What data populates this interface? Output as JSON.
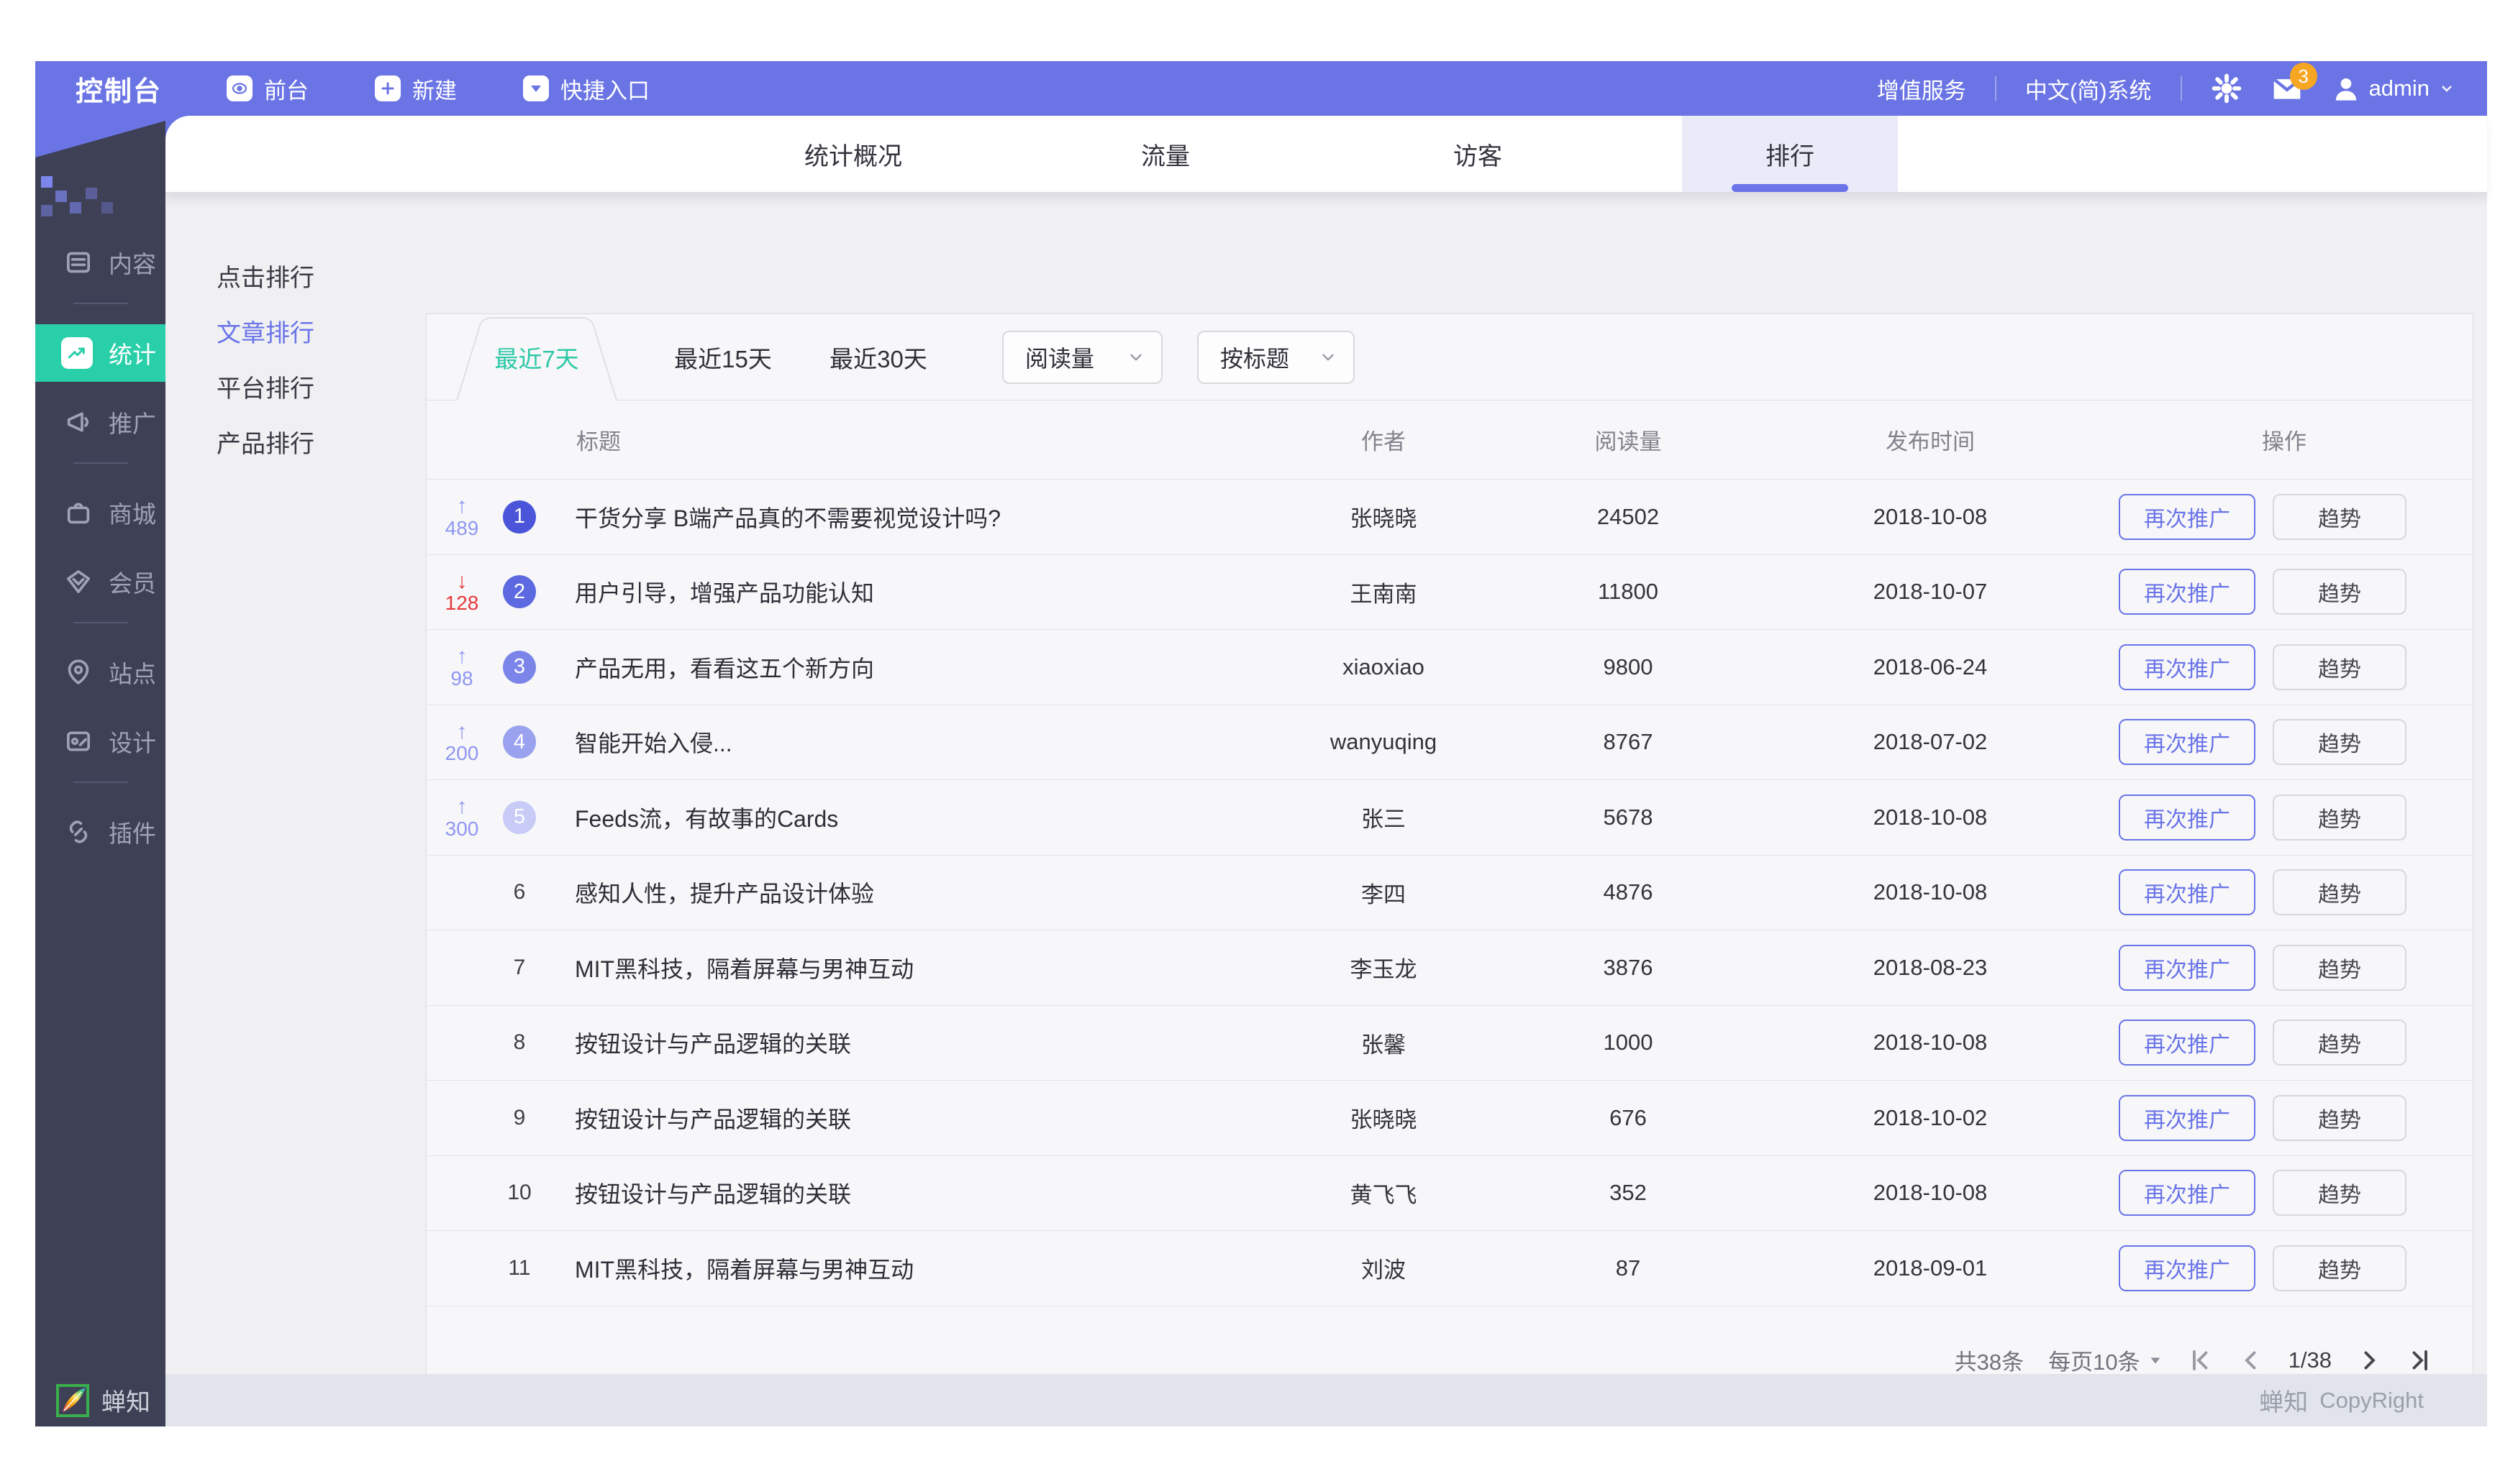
{
  "topbar": {
    "logo": "控制台",
    "menu": [
      {
        "label": "前台",
        "icon": "eye-icon"
      },
      {
        "label": "新建",
        "icon": "plus-icon"
      },
      {
        "label": "快捷入口",
        "icon": "caret-down-icon"
      }
    ],
    "right": {
      "value_added": "增值服务",
      "language": "中文(简)系统",
      "mail_badge": "3",
      "user": "admin"
    }
  },
  "sidebar": {
    "items": [
      {
        "label": "内容",
        "icon": "content-icon",
        "active": false,
        "divider_after": true
      },
      {
        "label": "统计",
        "icon": "stats-icon",
        "active": true,
        "divider_after": false
      },
      {
        "label": "推广",
        "icon": "promo-icon",
        "active": false,
        "divider_after": true
      },
      {
        "label": "商城",
        "icon": "shop-icon",
        "active": false,
        "divider_after": false
      },
      {
        "label": "会员",
        "icon": "member-icon",
        "active": false,
        "divider_after": true
      },
      {
        "label": "站点",
        "icon": "site-icon",
        "active": false,
        "divider_after": false
      },
      {
        "label": "设计",
        "icon": "design-icon",
        "active": false,
        "divider_after": true
      },
      {
        "label": "插件",
        "icon": "plugin-icon",
        "active": false,
        "divider_after": false
      }
    ],
    "brand": "蝉知"
  },
  "navbar": {
    "tabs": [
      {
        "label": "统计概况",
        "active": false
      },
      {
        "label": "流量",
        "active": false
      },
      {
        "label": "访客",
        "active": false
      },
      {
        "label": "排行",
        "active": true
      }
    ]
  },
  "side_menu": {
    "items": [
      {
        "label": "点击排行",
        "active": false
      },
      {
        "label": "文章排行",
        "active": true
      },
      {
        "label": "平台排行",
        "active": false
      },
      {
        "label": "产品排行",
        "active": false
      }
    ]
  },
  "filters": {
    "date_tabs": [
      {
        "label": "最近7天",
        "active": true
      },
      {
        "label": "最近15天",
        "active": false
      },
      {
        "label": "最近30天",
        "active": false
      }
    ],
    "selects": [
      {
        "value": "阅读量"
      },
      {
        "value": "按标题"
      }
    ]
  },
  "table": {
    "headers": [
      "标题",
      "作者",
      "阅读量",
      "发布时间",
      "操作"
    ],
    "action_labels": [
      "再次推广",
      "趋势"
    ],
    "rows": [
      {
        "rank": "1",
        "change": "489",
        "direction": "up",
        "badge_color": "#4a55d9",
        "title": "干货分享 B端产品真的不需要视觉设计吗?",
        "author": "张晓晓",
        "reads": "24502",
        "date": "2018-10-08"
      },
      {
        "rank": "2",
        "change": "128",
        "direction": "down",
        "badge_color": "#5d69e1",
        "title": "用户引导，增强产品功能认知",
        "author": "王南南",
        "reads": "11800",
        "date": "2018-10-07"
      },
      {
        "rank": "3",
        "change": "98",
        "direction": "up",
        "badge_color": "#7b85e9",
        "title": "产品无用，看看这五个新方向",
        "author": "xiaoxiao",
        "reads": "9800",
        "date": "2018-06-24"
      },
      {
        "rank": "4",
        "change": "200",
        "direction": "up",
        "badge_color": "#9aa2ef",
        "title": "智能开始入侵...",
        "author": "wanyuqing",
        "reads": "8767",
        "date": "2018-07-02"
      },
      {
        "rank": "5",
        "change": "300",
        "direction": "up",
        "badge_color": "#c7cbf6",
        "title": "Feeds流，有故事的Cards",
        "author": "张三",
        "reads": "5678",
        "date": "2018-10-08"
      },
      {
        "rank": "6",
        "change": "",
        "direction": "",
        "badge_color": "",
        "title": "感知人性，提升产品设计体验",
        "author": "李四",
        "reads": "4876",
        "date": "2018-10-08"
      },
      {
        "rank": "7",
        "change": "",
        "direction": "",
        "badge_color": "",
        "title": "MIT黑科技，隔着屏幕与男神互动",
        "author": "李玉龙",
        "reads": "3876",
        "date": "2018-08-23"
      },
      {
        "rank": "8",
        "change": "",
        "direction": "",
        "badge_color": "",
        "title": "按钮设计与产品逻辑的关联",
        "author": "张馨",
        "reads": "1000",
        "date": "2018-10-08"
      },
      {
        "rank": "9",
        "change": "",
        "direction": "",
        "badge_color": "",
        "title": "按钮设计与产品逻辑的关联",
        "author": "张晓晓",
        "reads": "676",
        "date": "2018-10-02"
      },
      {
        "rank": "10",
        "change": "",
        "direction": "",
        "badge_color": "",
        "title": "按钮设计与产品逻辑的关联",
        "author": "黄飞飞",
        "reads": "352",
        "date": "2018-10-08"
      },
      {
        "rank": "11",
        "change": "",
        "direction": "",
        "badge_color": "",
        "title": "MIT黑科技，隔着屏幕与男神互动",
        "author": "刘波",
        "reads": "87",
        "date": "2018-09-01"
      }
    ]
  },
  "pagination": {
    "total": "共38条",
    "per_page": "每页10条",
    "page": "1/38"
  },
  "footer": {
    "brand": "蝉知",
    "copyright": "CopyRight"
  },
  "colors": {
    "topbar": "#6a74e4",
    "sidebar": "#3e4056",
    "active_teal": "#29cfa9",
    "accent": "#6a74e8",
    "rank_up": "#8f97f2",
    "rank_down": "#e5383b",
    "mail_badge": "#f6a623",
    "tab_active_bg": "#eaebf8"
  }
}
